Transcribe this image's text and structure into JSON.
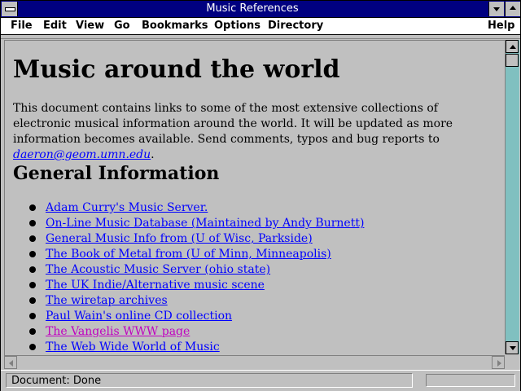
{
  "window": {
    "title": "Music References"
  },
  "menu": {
    "file": "File",
    "edit": "Edit",
    "view": "View",
    "go": "Go",
    "bookmarks": "Bookmarks",
    "options": "Options",
    "directory": "Directory",
    "help": "Help"
  },
  "page": {
    "heading": "Music around the world",
    "intro": "This document contains links to some of the most extensive collections of electronic musical information around the world. It will be updated as more information becomes available. Send comments, typos and bug reports to",
    "email": "daeron@geom.umn.edu",
    "intro_end": ".",
    "section_title": "General Information",
    "links": [
      {
        "label": "Adam Curry's Music Server.",
        "visited": false
      },
      {
        "label": "On-Line Music Database (Maintained by Andy Burnett)",
        "visited": false
      },
      {
        "label": "General Music Info from (U of Wisc, Parkside)",
        "visited": false
      },
      {
        "label": "The Book of Metal from (U of Minn, Minneapolis)",
        "visited": false
      },
      {
        "label": "The Acoustic Music Server (ohio state)",
        "visited": false
      },
      {
        "label": "The UK Indie/Alternative music scene",
        "visited": false
      },
      {
        "label": "The wiretap archives",
        "visited": false
      },
      {
        "label": "Paul Wain's online CD collection",
        "visited": false
      },
      {
        "label": "The Vangelis WWW page",
        "visited": true
      },
      {
        "label": "The Web Wide World of Music",
        "visited": false
      }
    ]
  },
  "status": {
    "text": "Document: Done"
  },
  "colors": {
    "titlebar": "#000080",
    "link": "#0000ff",
    "visited_link": "#c000c0",
    "scroll_track": "#80c0c0"
  },
  "icons": {
    "system_menu": "system-menu-icon",
    "minimize": "minimize-icon",
    "maximize": "maximize-icon"
  }
}
